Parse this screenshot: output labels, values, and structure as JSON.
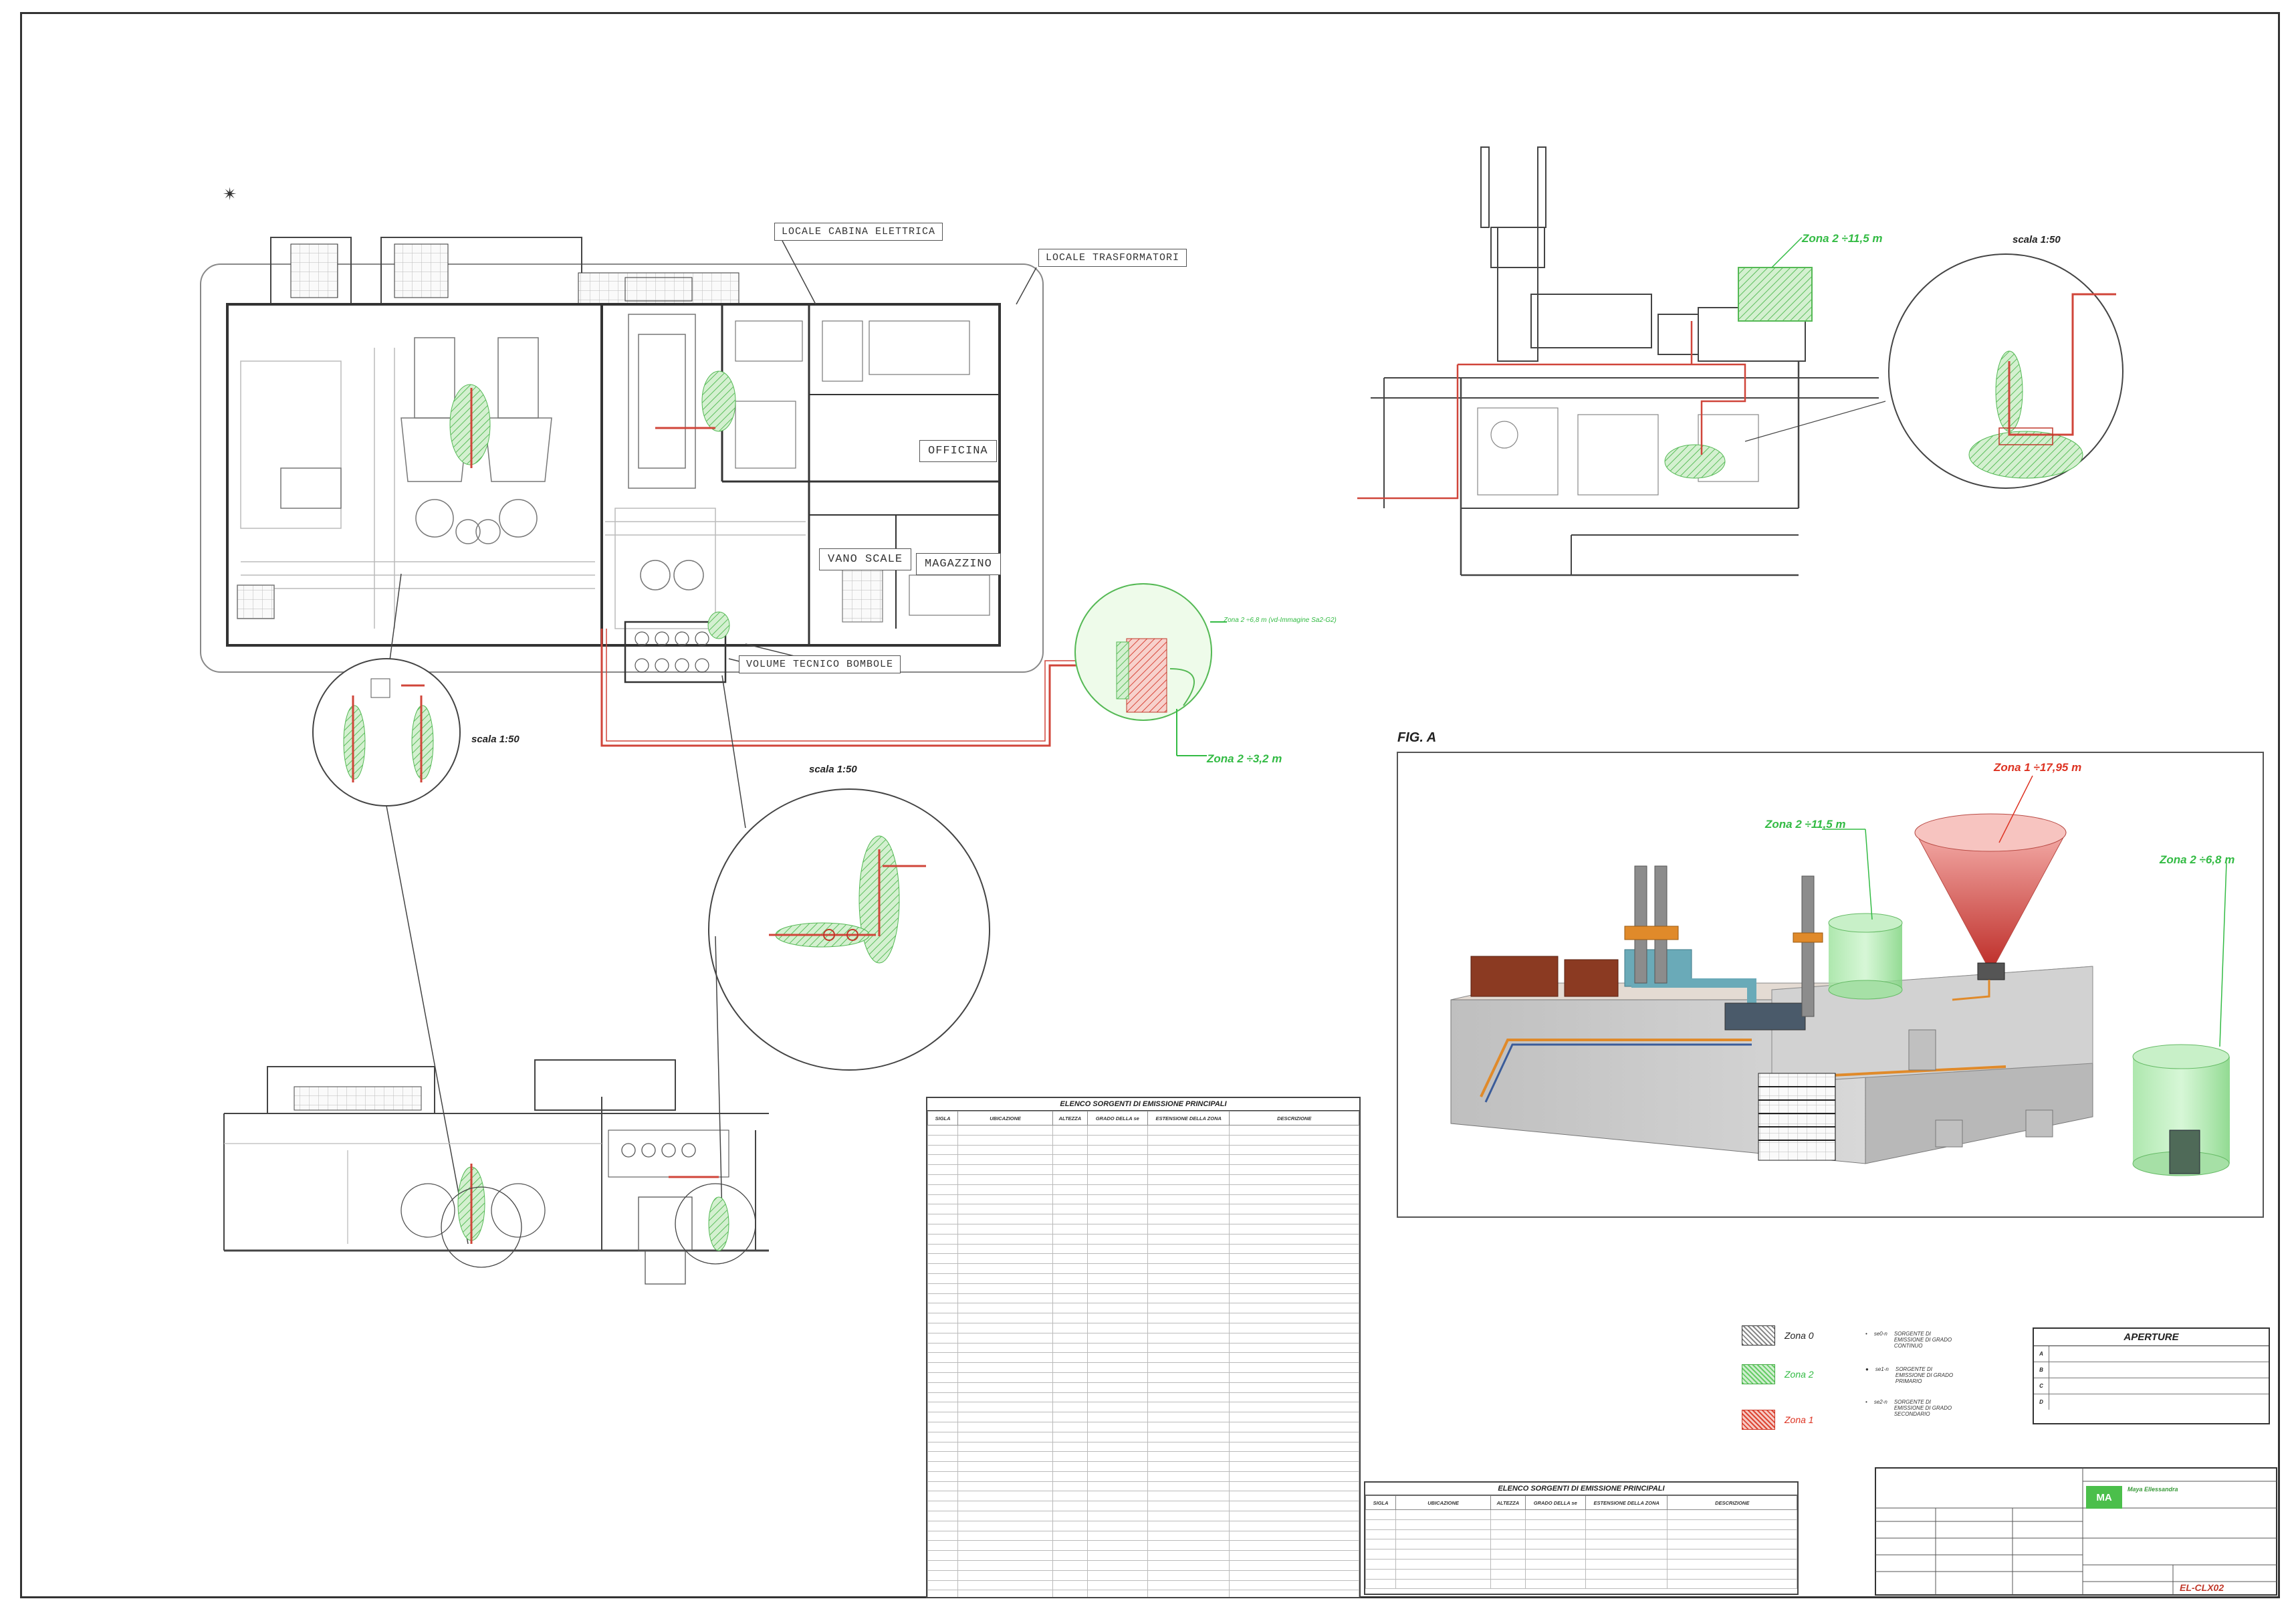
{
  "labels": {
    "cabina_elettrica": "LOCALE CABINA ELETTRICA",
    "trasformatori": "LOCALE TRASFORMATORI",
    "volume_bombole": "VOLUME TECNICO BOMBOLE",
    "officina": "OFFICINA",
    "vano_scale": "VANO SCALE",
    "magazzino": "MAGAZZINO"
  },
  "zones": {
    "plan_zona2_32": "Zona 2 ÷3,2 m",
    "plan_zona2_68_note": "Zona 2 ÷6,8 m (vd-Immagine Sa2-G2)",
    "elev_zona2_115": "Zona 2 ÷11,5 m",
    "fig_zona2_115": "Zona 2 ÷11,5 m",
    "fig_zona1_1795": "Zona 1 ÷17,95 m",
    "fig_zona2_68": "Zona 2 ÷6,8 m"
  },
  "scales": {
    "scale_a": "scala 1:50",
    "scale_b": "scala 1:50",
    "scale_c": "scala 1:50"
  },
  "fig_a": "FIG. A",
  "table_main": {
    "title": "ELENCO SORGENTI DI EMISSIONE PRINCIPALI",
    "headers": [
      "SIGLA",
      "UBICAZIONE",
      "ALTEZZA",
      "GRADO DELLA se",
      "ESTENSIONE DELLA ZONA",
      "DESCRIZIONE"
    ]
  },
  "table_small": {
    "title": "ELENCO SORGENTI DI EMISSIONE PRINCIPALI",
    "headers": [
      "SIGLA",
      "UBICAZIONE",
      "ALTEZZA",
      "GRADO DELLA se",
      "ESTENSIONE DELLA ZONA",
      "DESCRIZIONE"
    ]
  },
  "legend": {
    "zona0": "Zona 0",
    "zona2": "Zona 2",
    "zona1": "Zona 1",
    "src1_code": "se0-n",
    "src1_text": "SORGENTE DI EMISSIONE DI GRADO CONTINUO",
    "src2_code": "se1-n",
    "src2_text": "SORGENTE DI EMISSIONE DI GRADO PRIMARIO",
    "src3_code": "se2-n",
    "src3_text": "SORGENTE DI EMISSIONE DI GRADO SECONDARIO"
  },
  "aperture": {
    "title": "APERTURE",
    "keys": [
      "A",
      "B",
      "C",
      "D"
    ]
  },
  "title_block": {
    "logo": "MA",
    "company": "Maya Ellessandra",
    "code": "EL-CLX02"
  },
  "colors": {
    "zone_green": "#33bb44",
    "zone_red": "#dd3322",
    "pipe_red": "#d0453a",
    "building_grey": "#c7c7c7"
  }
}
